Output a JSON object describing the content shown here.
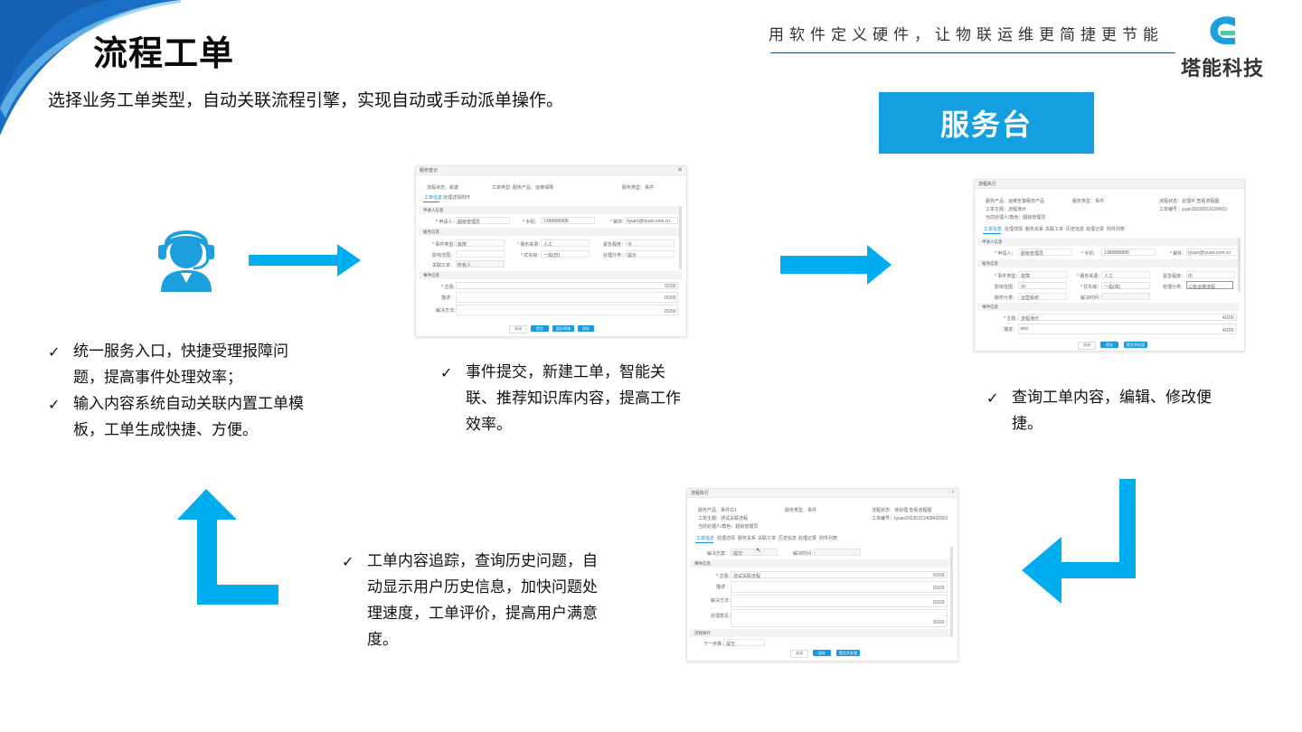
{
  "header": {
    "title": "流程工单",
    "subtitle": "选择业务工单类型，自动关联流程引擎，实现自动或手动派单操作。",
    "slogan": "用软件定义硬件，让物联运维更简捷更节能",
    "brand_name": "塔能科技",
    "brand_color": "#1c9fdc",
    "brand_accent": "#54c6a9"
  },
  "service_desk_label": "服务台",
  "accent_color": "#14a0e0",
  "arrow_color": "#00aeef",
  "check_mark": "✓",
  "bullet_groups": {
    "left": [
      "统一服务入口，快捷受理报障问题，提高事件处理效率；",
      "输入内容系统自动关联内置工单模板，工单生成快捷、方便。"
    ],
    "middle": [
      "事件提交，新建工单，智能关联、推荐知识库内容，提高工作效率。"
    ],
    "right": [
      "查询工单内容，编辑、修改便捷。"
    ],
    "bottom": [
      "工单内容追踪，查询历史问题，自动显示用户历史信息，加快问题处理速度，工单评价，提高用户满意度。"
    ]
  },
  "icons": {
    "agent": "headset-user-icon",
    "check": "checkmark-icon",
    "arrows": [
      "arrow-right-icon",
      "arrow-right-icon",
      "arrow-down-left-icon",
      "arrow-up-right-icon"
    ]
  },
  "screens": {
    "new_ticket": {
      "window_title": "服务登记",
      "info": [
        "流程状态：新建",
        "工单类型：",
        "服务产品：运维保障",
        "服务类型：事件"
      ],
      "tabs": [
        "工单信息",
        "处理详情",
        "附件"
      ],
      "sections": [
        "申请人信息",
        "服务信息",
        "事件信息"
      ],
      "fields": [
        "* 申请人：",
        "超级管理员",
        "* 手机：",
        "1388888888",
        "* 邮件：",
        "tyuan@tyuan.com.cn",
        "* 事件类型：",
        "故障",
        "* 服务来源：",
        "人工",
        "紧急程度：",
        "中",
        "影响范围：",
        "* 优先级：",
        "一般(低)",
        "处理分类：",
        "提示",
        "所有人",
        "关联工单：",
        "* 主题：",
        "描述：",
        "解决方法："
      ],
      "counters": [
        "0/200",
        "0/200",
        "0/200"
      ],
      "buttons": [
        "关闭",
        "提交",
        "暂存草稿",
        "保存"
      ]
    },
    "view_ticket": {
      "window_title": "流程执行",
      "info": [
        "服务产品：运维告警服务产品",
        "服务类型：事件",
        "流程状态：处理中 查看流程图",
        "工单主题：流程演示",
        "工单编号：yuan20230519120603",
        "当前处理人/角色：超级管理员"
      ],
      "tabs": [
        "工单信息",
        "处理详情",
        "服务关系",
        "关联工单",
        "历史信息",
        "处理记录",
        "附件列表"
      ],
      "sections": [
        "申请人信息",
        "服务信息",
        "事件信息"
      ],
      "fields": [
        "* 申请人：",
        "超级管理员",
        "* 手机：",
        "1388888888",
        "* 邮件：",
        "tyuan@tyuan.com.cn",
        "* 事件类型：",
        "故障",
        "* 服务来源：",
        "人工",
        "紧急程度：",
        "中",
        "影响范围：",
        "中",
        "* 优先级：",
        "一般(高)",
        "处理分类：",
        "三级运维流程",
        "服务分类：",
        "运营系统",
        "解决时间：",
        "* 主题：",
        "流程演示",
        "描述：",
        "test"
      ],
      "counters": [
        "4/200",
        "4/200"
      ],
      "buttons": [
        "关闭",
        "保存",
        "提交并处理"
      ]
    },
    "track_ticket": {
      "window_title": "流程执行",
      "info": [
        "服务产品：事件111",
        "服务类型：事件",
        "流程状态：待处理 查看流程图",
        "工单主题：测试关联流程",
        "工单编号：tyuan20230221408420901",
        "当前处理人/角色：超级管理员"
      ],
      "tabs": [
        "工单信息",
        "处理详情",
        "服务关系",
        "关联工单",
        "历史信息",
        "处理记录",
        "附件列表"
      ],
      "sections": [
        "事件信息",
        "流程执行"
      ],
      "fields": [
        "解决方案：",
        "提交",
        "解决时间：",
        "* 主题：",
        "测试关联流程",
        "描述：",
        "解决方法：",
        "处理意见：",
        "下一步骤：",
        "提交"
      ],
      "counters": [
        "6/200",
        "0/200",
        "0/200",
        "0/200"
      ],
      "buttons": [
        "关闭",
        "保存",
        "提交并处理"
      ]
    }
  }
}
